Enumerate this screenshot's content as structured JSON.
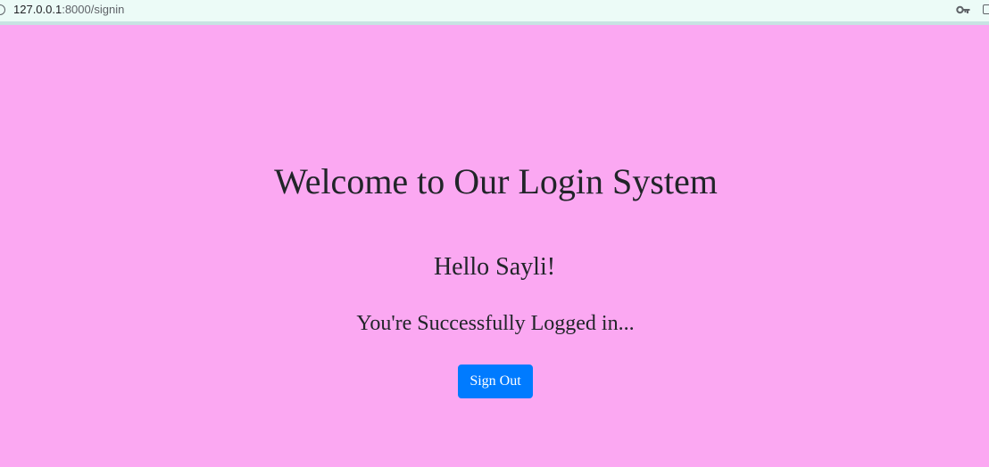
{
  "browser": {
    "url_host": "127.0.0.1",
    "url_path": ":8000/signin",
    "icons": {
      "site_info": "info-circle-icon",
      "password": "key-icon",
      "extension": "extension-icon"
    }
  },
  "page": {
    "title": "Welcome to Our Login System",
    "greeting": "Hello Sayli!",
    "message": "You're Successfully Logged in...",
    "signout_label": "Sign Out"
  },
  "colors": {
    "page_background": "#fba8f2",
    "button": "#007bff",
    "button_text": "#ffffff",
    "text": "#212529",
    "address_bar": "#ecfbf7"
  }
}
